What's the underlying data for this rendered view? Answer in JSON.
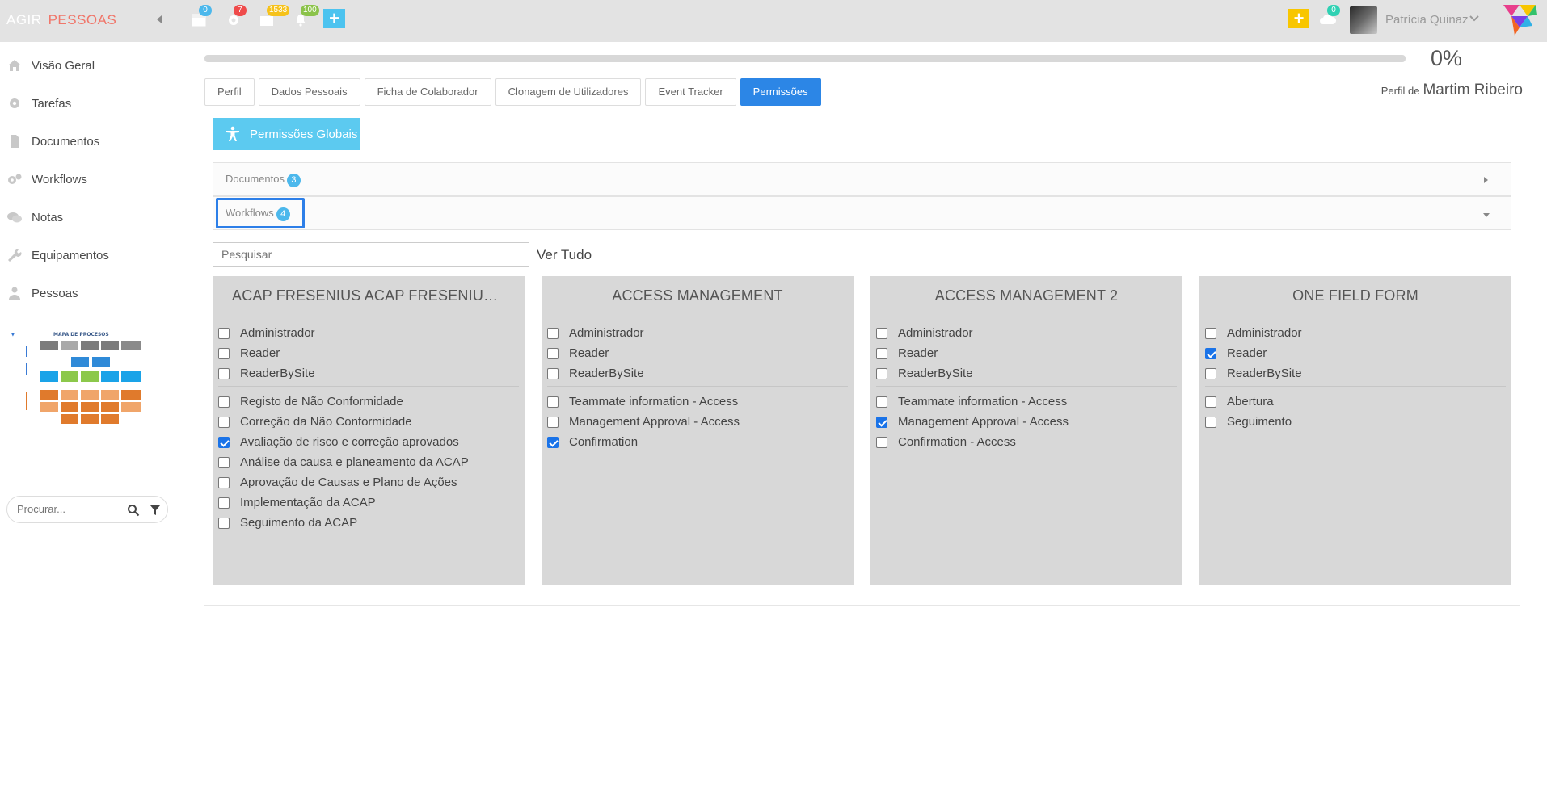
{
  "app": {
    "brand_part1": "AGIR",
    "brand_part2": "PESSOAS"
  },
  "topbar": {
    "badges": {
      "calendar": "0",
      "settings": "7",
      "inbox": "1533",
      "notifications": "100",
      "cloud": "0"
    },
    "user_name": "Patrícia Quinaz",
    "colors": {
      "plus_blue": "#4cc3ef",
      "plus_yellow": "#f8c600"
    }
  },
  "sidebar": {
    "items": [
      {
        "label": "Visão Geral",
        "icon": "home-icon"
      },
      {
        "label": "Tarefas",
        "icon": "gear-icon"
      },
      {
        "label": "Documentos",
        "icon": "document-icon"
      },
      {
        "label": "Workflows",
        "icon": "gears-icon"
      },
      {
        "label": "Notas",
        "icon": "chat-icon"
      },
      {
        "label": "Equipamentos",
        "icon": "wrench-icon"
      },
      {
        "label": "Pessoas",
        "icon": "person-icon"
      }
    ],
    "search_placeholder": "Procurar..."
  },
  "progress": {
    "value": 0,
    "label": "0%"
  },
  "tabs": [
    "Perfil",
    "Dados Pessoais",
    "Ficha de Colaborador",
    "Clonagem de Utilizadores",
    "Event Tracker",
    "Permissões"
  ],
  "active_tab": "Permissões",
  "profile": {
    "prefix": "Perfil de",
    "name": "Martim Ribeiro"
  },
  "global_permissions_label": "Permissões Globais",
  "accordion": [
    {
      "label": "Documentos",
      "count": "3"
    },
    {
      "label": "Workflows",
      "count": "4"
    }
  ],
  "search": {
    "placeholder": "Pesquisar"
  },
  "ver_tudo": "Ver Tudo",
  "cards": [
    {
      "title": "ACAP FRESENIUS ACAP FRESENIUS AC...",
      "roles": [
        {
          "label": "Administrador",
          "checked": false
        },
        {
          "label": "Reader",
          "checked": false
        },
        {
          "label": "ReaderBySite",
          "checked": false
        }
      ],
      "steps": [
        {
          "label": "Registo de Não Conformidade",
          "checked": false
        },
        {
          "label": "Correção da Não Conformidade",
          "checked": false
        },
        {
          "label": "Avaliação de risco e correção aprovados",
          "checked": true
        },
        {
          "label": "Análise da causa e planeamento da ACAP",
          "checked": false
        },
        {
          "label": "Aprovação de Causas e Plano de Ações",
          "checked": false
        },
        {
          "label": "Implementação da ACAP",
          "checked": false
        },
        {
          "label": "Seguimento da ACAP",
          "checked": false
        }
      ]
    },
    {
      "title": "ACCESS MANAGEMENT",
      "roles": [
        {
          "label": "Administrador",
          "checked": false
        },
        {
          "label": "Reader",
          "checked": false
        },
        {
          "label": "ReaderBySite",
          "checked": false
        }
      ],
      "steps": [
        {
          "label": "Teammate information - Access",
          "checked": false
        },
        {
          "label": "Management Approval - Access",
          "checked": false
        },
        {
          "label": "Confirmation",
          "checked": true
        }
      ]
    },
    {
      "title": "ACCESS MANAGEMENT 2",
      "roles": [
        {
          "label": "Administrador",
          "checked": false
        },
        {
          "label": "Reader",
          "checked": false
        },
        {
          "label": "ReaderBySite",
          "checked": false
        }
      ],
      "steps": [
        {
          "label": "Teammate information - Access",
          "checked": false
        },
        {
          "label": "Management Approval - Access",
          "checked": true
        },
        {
          "label": "Confirmation - Access",
          "checked": false
        }
      ]
    },
    {
      "title": "ONE FIELD FORM",
      "roles": [
        {
          "label": "Administrador",
          "checked": false
        },
        {
          "label": "Reader",
          "checked": true
        },
        {
          "label": "ReaderBySite",
          "checked": false
        }
      ],
      "steps": [
        {
          "label": "Abertura",
          "checked": false
        },
        {
          "label": "Seguimento",
          "checked": false
        }
      ]
    }
  ],
  "process_map": {
    "title": "MAPA DE PROCESOS"
  }
}
